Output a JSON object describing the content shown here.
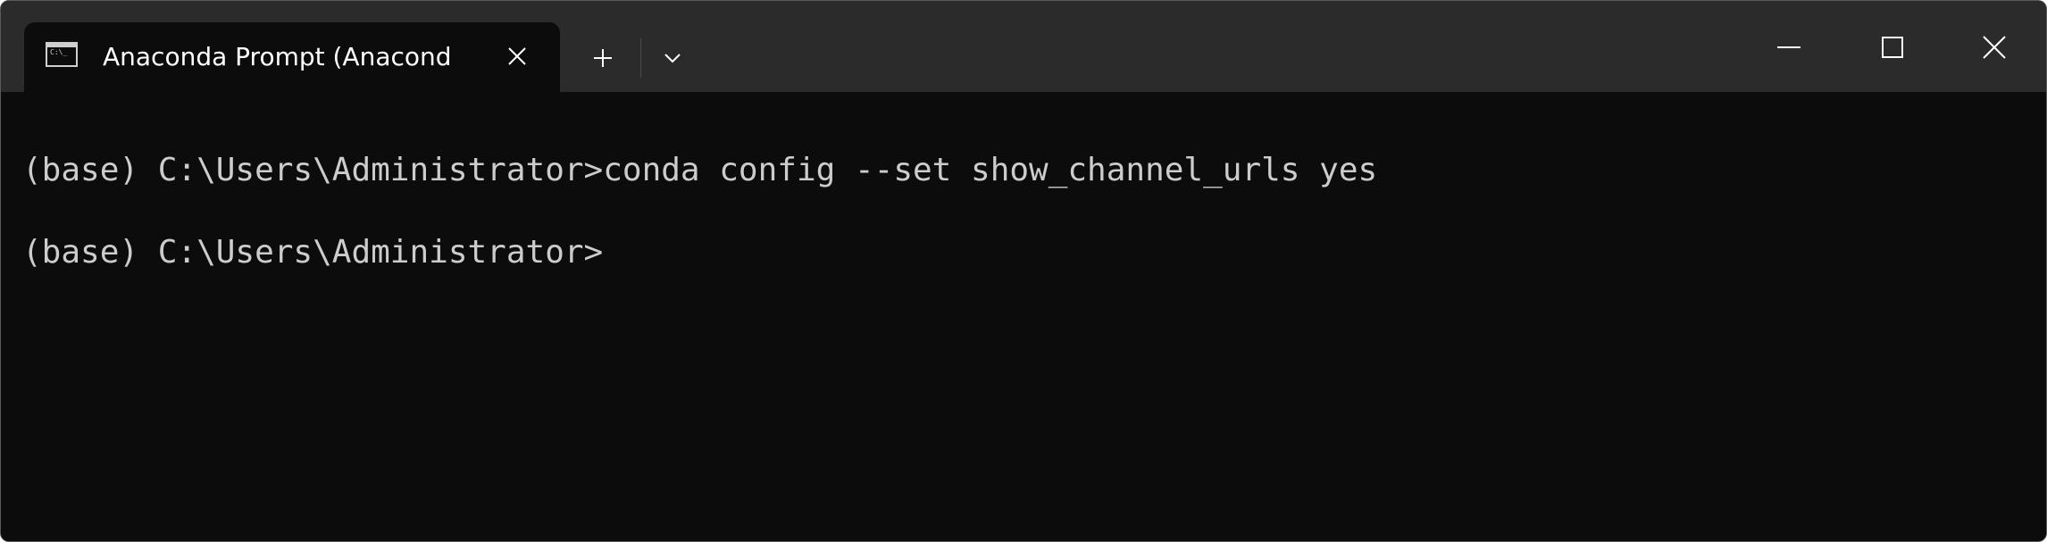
{
  "tab": {
    "title": "Anaconda Prompt (Anacond",
    "icon": "console-icon"
  },
  "tab_actions": {
    "close_icon": "close-icon",
    "new_tab_icon": "plus-icon",
    "dropdown_icon": "chevron-down-icon"
  },
  "window_controls": {
    "minimize_icon": "minimize-icon",
    "maximize_icon": "maximize-icon",
    "close_icon": "close-icon"
  },
  "terminal": {
    "lines": [
      "(base) C:\\Users\\Administrator>conda config --set show_channel_urls yes",
      "(base) C:\\Users\\Administrator>"
    ]
  },
  "colors": {
    "titlebar": "#2b2b2b",
    "terminal_bg": "#0c0c0c",
    "terminal_text": "#cccccc"
  }
}
